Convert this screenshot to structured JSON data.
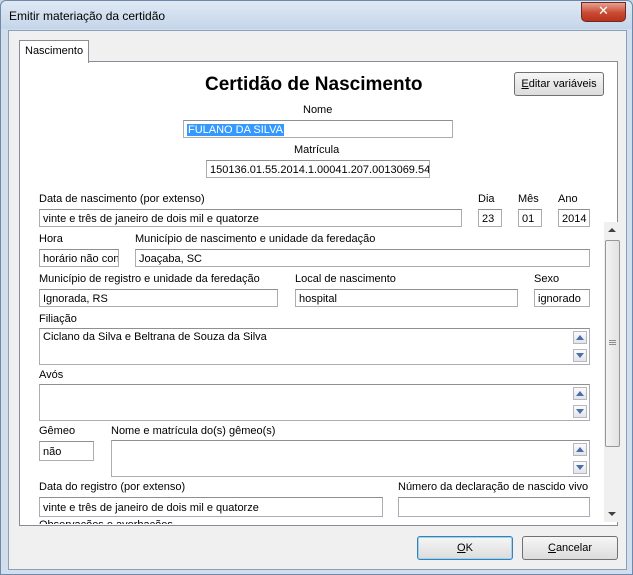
{
  "window": {
    "title": "Emitir materiação da certidão"
  },
  "tabs": [
    {
      "label": "Nascimento"
    }
  ],
  "form": {
    "heading": "Certidão de Nascimento",
    "edit_vars_prefix": "E",
    "edit_vars_rest": "ditar variáveis",
    "nome": {
      "label": "Nome",
      "value": "FULANO DA SILVA"
    },
    "matricula": {
      "label": "Matrícula",
      "value": "150136.01.55.2014.1.00041.207.0013069.54"
    },
    "data_nascimento": {
      "label": "Data de nascimento (por extenso)",
      "value": "vinte e três de janeiro de dois mil e quatorze"
    },
    "dia": {
      "label": "Dia",
      "value": "23"
    },
    "mes": {
      "label": "Mês",
      "value": "01"
    },
    "ano": {
      "label": "Ano",
      "value": "2014"
    },
    "hora": {
      "label": "Hora",
      "value": "horário não con"
    },
    "municipio_nascimento": {
      "label": "Município de nascimento e unidade da feredação",
      "value": "Joaçaba, SC"
    },
    "municipio_registro": {
      "label": "Município de registro e unidade da feredação",
      "value": "Ignorada, RS"
    },
    "local_nascimento": {
      "label": "Local de nascimento",
      "value": "hospital"
    },
    "sexo": {
      "label": "Sexo",
      "value": "ignorado"
    },
    "filiacao": {
      "label": "Filiação",
      "value": "Ciclano da Silva e Beltrana de Souza da Silva"
    },
    "avos": {
      "label": "Avós",
      "value": ""
    },
    "gemeo": {
      "label": "Gêmeo",
      "value": "não"
    },
    "gemeos_nomes": {
      "label": "Nome e matrícula do(s) gêmeo(s)",
      "value": ""
    },
    "data_registro": {
      "label": "Data do registro (por extenso)",
      "value": "vinte e três de janeiro de dois mil e quatorze"
    },
    "declaracao": {
      "label": "Número da declaração de nascido vivo",
      "value": ""
    },
    "observacoes_partial": "Observações e averbações"
  },
  "buttons": {
    "ok_prefix": "O",
    "ok_rest": "K",
    "cancel_prefix": "C",
    "cancel_rest": "ancelar"
  }
}
